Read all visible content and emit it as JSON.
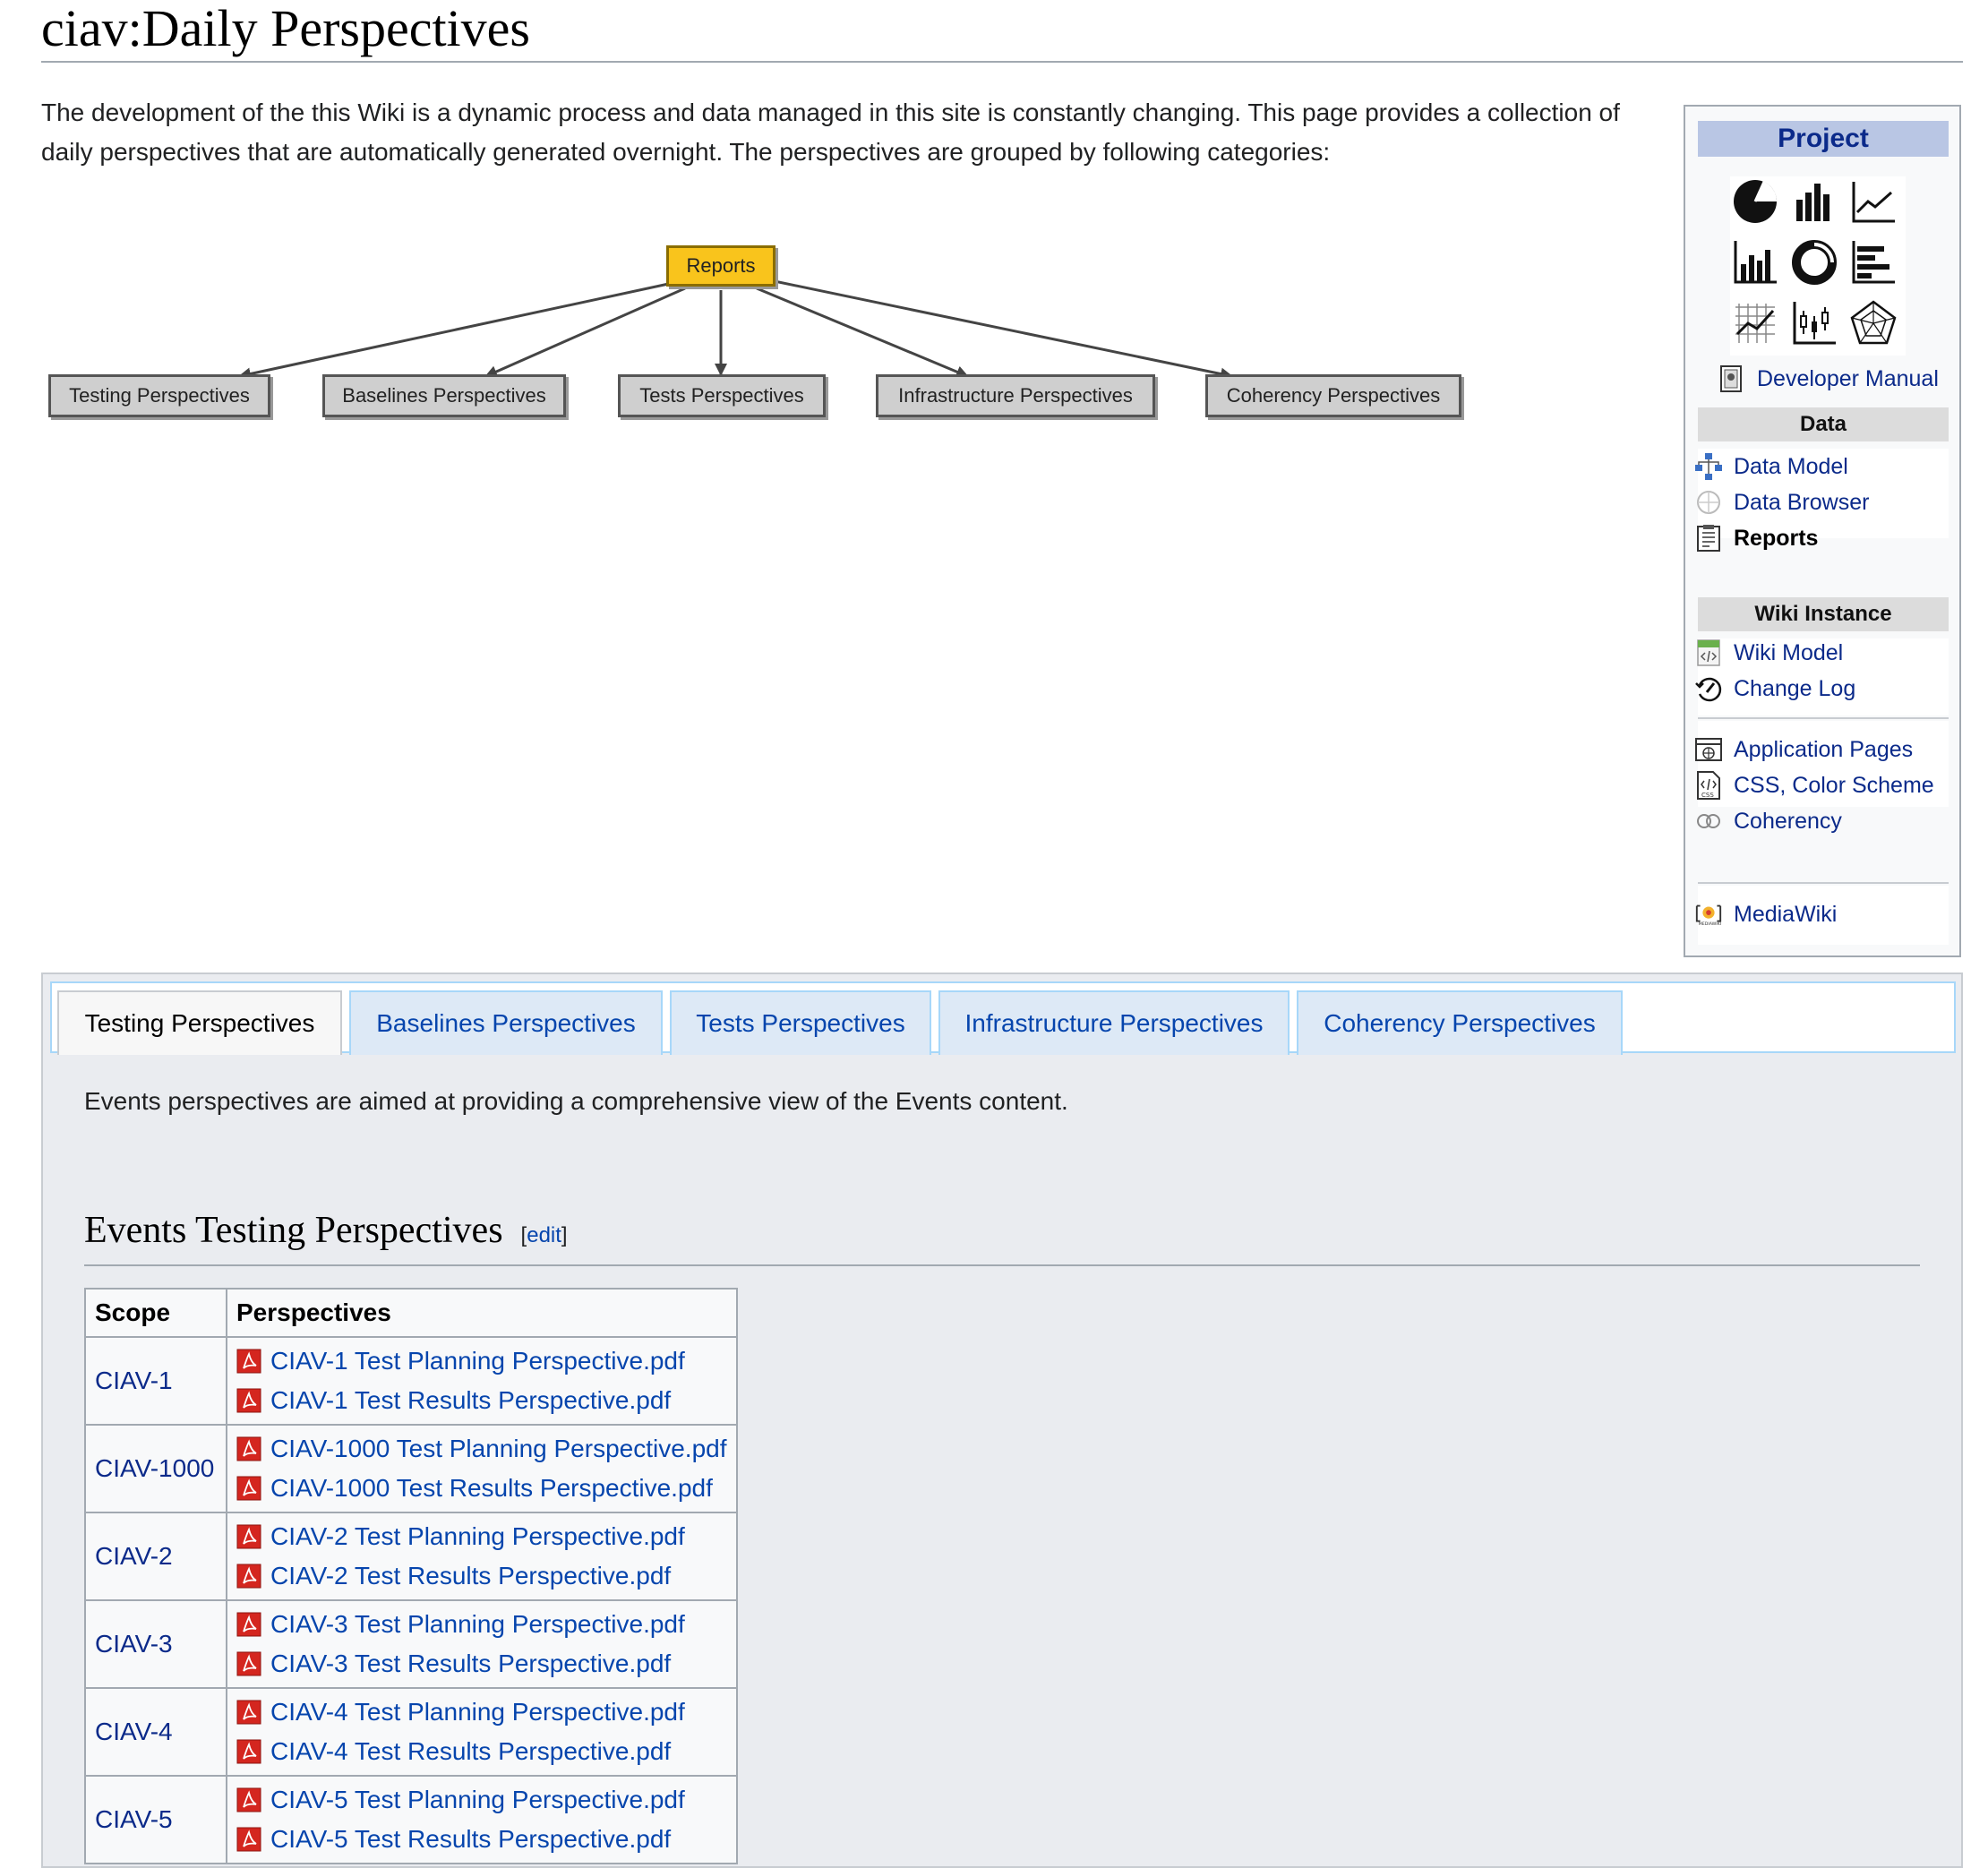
{
  "page": {
    "title": "ciav:Daily Perspectives",
    "intro": "The development of the this Wiki is a dynamic process and data managed in this site is constantly changing. This page provides a collection of daily perspectives that are automatically generated overnight. The perspectives are grouped by following categories:"
  },
  "diagram": {
    "root": "Reports",
    "children": [
      "Testing Perspectives",
      "Baselines Perspectives",
      "Tests Perspectives",
      "Infrastructure Perspectives",
      "Coherency Perspectives"
    ]
  },
  "sidebar": {
    "project_heading": "Project",
    "chart_icons": [
      "pie-chart-icon",
      "bar-chart-icon",
      "line-chart-icon",
      "column-chart-icon",
      "donut-chart-icon",
      "horizontal-bar-chart-icon",
      "grid-line-chart-icon",
      "candlestick-chart-icon",
      "radar-chart-icon"
    ],
    "developer_manual": "Developer Manual",
    "data_heading": "Data",
    "data_items": [
      "Data Model",
      "Data Browser",
      "Reports"
    ],
    "wiki_heading": "Wiki Instance",
    "wiki_items": [
      "Wiki Model",
      "Change Log"
    ],
    "app_items": [
      "Application Pages",
      "CSS, Color Scheme",
      "Coherency"
    ],
    "mediawiki": "MediaWiki"
  },
  "tabs": {
    "items": [
      "Testing Perspectives",
      "Baselines Perspectives",
      "Tests Perspectives",
      "Infrastructure Perspectives",
      "Coherency Perspectives"
    ],
    "active": "Testing Perspectives",
    "description": "Events perspectives are aimed at providing a comprehensive view of the Events content."
  },
  "section": {
    "title": "Events Testing Perspectives",
    "edit_open": "[",
    "edit_label": "edit",
    "edit_close": "]"
  },
  "table": {
    "headers": [
      "Scope",
      "Perspectives"
    ],
    "rows": [
      {
        "scope": "CIAV-1",
        "files": [
          "CIAV-1 Test Planning Perspective.pdf",
          "CIAV-1 Test Results Perspective.pdf"
        ]
      },
      {
        "scope": "CIAV-1000",
        "files": [
          "CIAV-1000 Test Planning Perspective.pdf",
          "CIAV-1000 Test Results Perspective.pdf"
        ]
      },
      {
        "scope": "CIAV-2",
        "files": [
          "CIAV-2 Test Planning Perspective.pdf",
          "CIAV-2 Test Results Perspective.pdf"
        ]
      },
      {
        "scope": "CIAV-3",
        "files": [
          "CIAV-3 Test Planning Perspective.pdf",
          "CIAV-3 Test Results Perspective.pdf"
        ]
      },
      {
        "scope": "CIAV-4",
        "files": [
          "CIAV-4 Test Planning Perspective.pdf",
          "CIAV-4 Test Results Perspective.pdf"
        ]
      },
      {
        "scope": "CIAV-5",
        "files": [
          "CIAV-5 Test Planning Perspective.pdf",
          "CIAV-5 Test Results Perspective.pdf"
        ]
      }
    ]
  },
  "colors": {
    "link": "#0645ad",
    "nav_link": "#0b2a8a",
    "reports_node": "#f9c41c",
    "project_heading_bg": "#b9c6e4",
    "pdf_red": "#d4261f"
  }
}
